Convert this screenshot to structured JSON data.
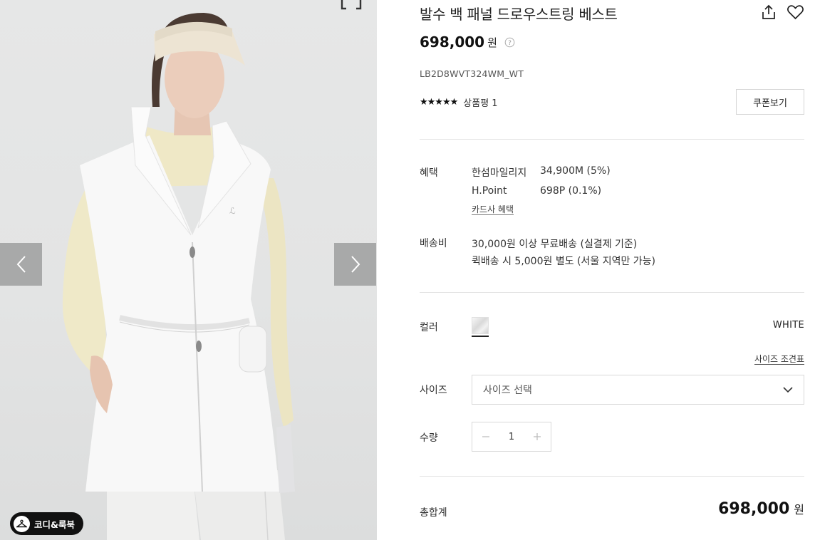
{
  "product": {
    "title": "발수 백 패널 드로우스트링 베스트",
    "price": "698,000",
    "price_unit": "원",
    "sku": "LB2D8WVT324WM_WT",
    "stars": "★★★★★",
    "rating_fraction": 1.0,
    "review_label": "상품평 1"
  },
  "actions": {
    "coupon_label": "쿠폰보기",
    "coordi_label": "코디&룩북"
  },
  "benefit": {
    "label": "혜택",
    "items": [
      {
        "name": "한섬마일리지",
        "value": "34,900M (5%)"
      },
      {
        "name": "H.Point",
        "value": "698P (0.1%)"
      }
    ],
    "card_link": "카드사 혜택"
  },
  "shipping": {
    "label": "배송비",
    "line1": "30,000원 이상 무료배송 (실결제 기준)",
    "line2": "퀵배송 시 5,000원 별도 (서울 지역만 가능)"
  },
  "options": {
    "color_label": "컬러",
    "color_name": "WHITE",
    "size_chart_link": "사이즈 조견표",
    "size_label": "사이즈",
    "size_placeholder": "사이즈 선택",
    "qty_label": "수량",
    "qty_value": "1"
  },
  "total": {
    "label": "총합계",
    "price": "698,000",
    "unit": "원"
  },
  "colors": {
    "accent": "#111111",
    "border": "#d8d8d8",
    "divider": "#e3e3e3",
    "nav_overlay": "#787878"
  },
  "icons": [
    "expand-icon",
    "chevron-left-icon",
    "chevron-right-icon",
    "share-icon",
    "heart-icon",
    "help-icon",
    "chevron-down-icon",
    "minus-icon",
    "plus-icon",
    "hanger-icon"
  ]
}
